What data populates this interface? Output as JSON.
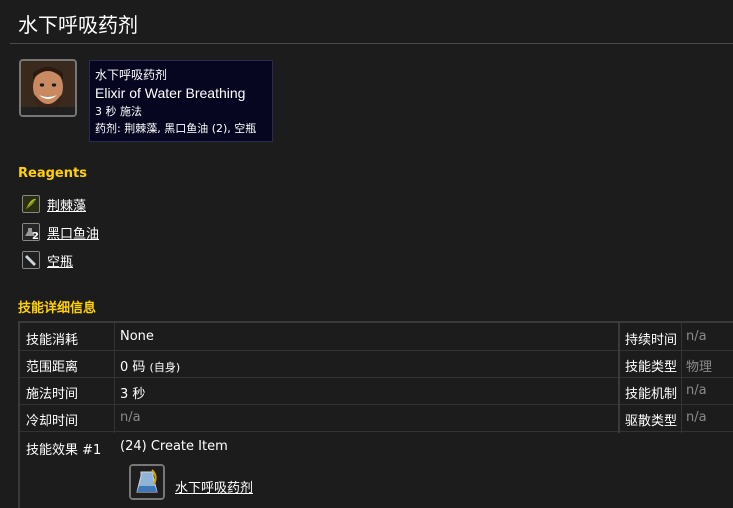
{
  "page": {
    "title": "水下呼吸药剂"
  },
  "tooltip": {
    "name_cn": "水下呼吸药剂",
    "name_en": "Elixir of Water Breathing",
    "cast": "3 秒 施法",
    "reagents_line": "药剂: 荆棘藻, 黑口鱼油 (2), 空瓶"
  },
  "reagents": {
    "heading": "Reagents",
    "items": [
      {
        "name": "荆棘藻",
        "icon": "leaf-herb-icon",
        "qty": ""
      },
      {
        "name": "黑口鱼油",
        "icon": "oil-flask-icon",
        "qty": "2"
      },
      {
        "name": "空瓶",
        "icon": "empty-vial-icon",
        "qty": ""
      }
    ]
  },
  "details": {
    "heading": "技能详细信息",
    "rows": [
      {
        "label": "技能消耗",
        "value": "None",
        "muted": false
      },
      {
        "label": "范围距离",
        "value": "0 码",
        "suffix": "(自身)",
        "muted": false
      },
      {
        "label": "施法时间",
        "value": "3 秒",
        "muted": false
      },
      {
        "label": "冷却时间",
        "value": "n/a",
        "muted": true
      }
    ],
    "right_rows": [
      {
        "label": "持续时间",
        "value": "n/a"
      },
      {
        "label": "技能类型",
        "value": "物理"
      },
      {
        "label": "技能机制",
        "value": "n/a"
      },
      {
        "label": "驱散类型",
        "value": "n/a"
      }
    ],
    "effect": {
      "label": "技能效果 #1",
      "value": "(24) Create Item",
      "item_name": "水下呼吸药剂",
      "item_icon": "potion-flask-icon"
    }
  },
  "colors": {
    "accent": "#ffd100",
    "background": "#1c1c1c",
    "tooltip_bg": "#060620"
  }
}
